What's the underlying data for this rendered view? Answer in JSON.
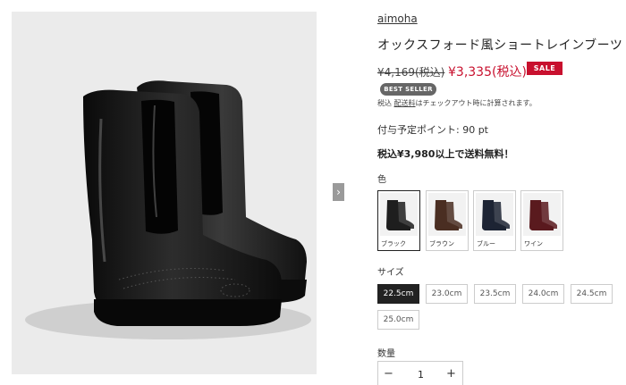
{
  "product": {
    "brand": "aimoha",
    "title": "オックスフォード風ショートレインブーツ",
    "original_price": "¥4,169(税込)",
    "sale_price": "¥3,335(税込)",
    "sale_badge": "SALE",
    "best_seller_badge": "BEST SELLER",
    "tax_note_prefix": "税込 ",
    "tax_note_link": "配送料",
    "tax_note_suffix": "はチェックアウト時に計算されます。",
    "points": "付与予定ポイント: 90 pt",
    "free_shipping": "税込¥3,980以上で送料無料！"
  },
  "colors": {
    "label": "色",
    "options": [
      {
        "label": "ブラック",
        "selected": true,
        "hex": "#1e1e1e"
      },
      {
        "label": "ブラウン",
        "selected": false,
        "hex": "#4a2e22"
      },
      {
        "label": "ブルー",
        "selected": false,
        "hex": "#1d2434"
      },
      {
        "label": "ワイン",
        "selected": false,
        "hex": "#5a1a1e"
      }
    ]
  },
  "sizes": {
    "label": "サイズ",
    "options": [
      {
        "label": "22.5cm",
        "selected": true
      },
      {
        "label": "23.0cm",
        "selected": false
      },
      {
        "label": "23.5cm",
        "selected": false
      },
      {
        "label": "24.0cm",
        "selected": false
      },
      {
        "label": "24.5cm",
        "selected": false
      },
      {
        "label": "25.0cm",
        "selected": false
      }
    ]
  },
  "quantity": {
    "label": "数量",
    "minus": "−",
    "value": "1",
    "plus": "+"
  },
  "gallery": {
    "next_icon": "›"
  },
  "theme": {
    "sale_red": "#c8102e",
    "badge_gray": "#666666"
  }
}
